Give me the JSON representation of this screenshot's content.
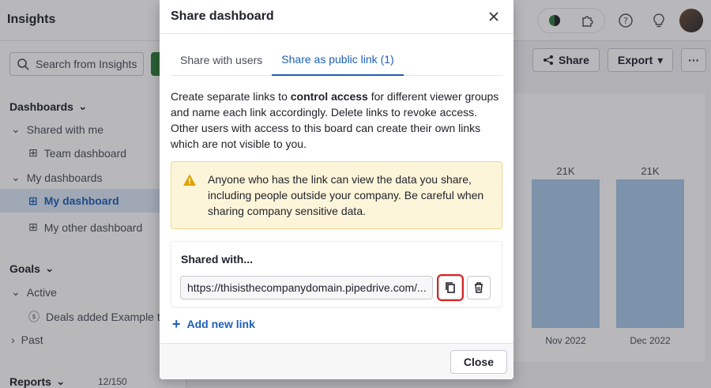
{
  "app": {
    "title": "Insights"
  },
  "topbar": {
    "icons": [
      "theme-toggle-icon",
      "puzzle-icon",
      "help-icon",
      "lightbulb-icon",
      "avatar"
    ]
  },
  "sidebar": {
    "search_placeholder": "Search from Insights",
    "dashboards_heading": "Dashboards",
    "shared_with_me": "Shared with me",
    "team_dashboard": "Team dashboard",
    "my_dashboards": "My dashboards",
    "my_dashboard": "My dashboard",
    "my_other_dashboard": "My other dashboard",
    "goals_heading": "Goals",
    "active": "Active",
    "deals_goal": "Deals added Example t...",
    "past": "Past",
    "reports_heading": "Reports",
    "reports_count": "12/150"
  },
  "toolbar": {
    "share_label": "Share",
    "export_label": "Export",
    "more_label": "···"
  },
  "chart_data": {
    "type": "bar",
    "categories": [
      "Nov 2022",
      "Dec 2022"
    ],
    "values": [
      21000,
      21000
    ],
    "data_labels": [
      "21K",
      "21K"
    ]
  },
  "modal": {
    "title": "Share dashboard",
    "tabs": [
      {
        "label": "Share with users",
        "active": false
      },
      {
        "label": "Share as public link (1)",
        "active": true
      }
    ],
    "desc_pre": "Create separate links to ",
    "desc_bold": "control access",
    "desc_post": " for different viewer groups and name each link accordingly. Delete links to revoke access. Other users with access to this board can create their own links which are not visible to you.",
    "warning": "Anyone who has the link can view the data you share, including people outside your company. Be careful when sharing company sensitive data.",
    "shared_with_title": "Shared with...",
    "link_value": "https://thisisthecompanydomain.pipedrive.com/...",
    "add_link_label": "Add new link",
    "close_label": "Close"
  },
  "colors": {
    "accent": "#1c5fb8",
    "warning_bg": "#fdf5d9",
    "highlight": "#e02020",
    "bar": "#a9c8e8"
  }
}
